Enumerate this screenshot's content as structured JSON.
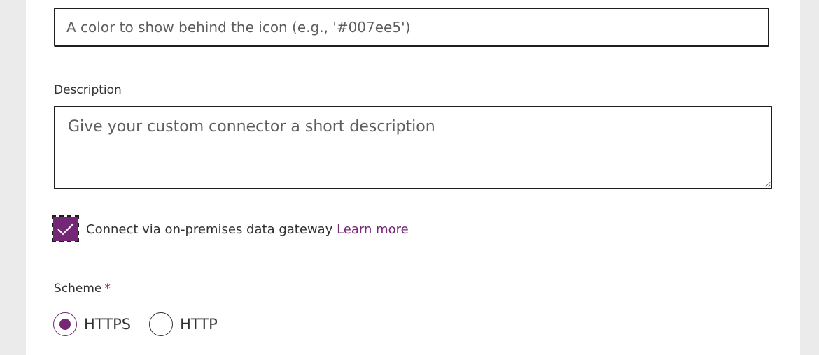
{
  "icon_background": {
    "placeholder": "A color to show behind the icon (e.g., '#007ee5')",
    "value": ""
  },
  "description": {
    "label": "Description",
    "placeholder": "Give your custom connector a short description",
    "value": ""
  },
  "gateway": {
    "checked": true,
    "label": "Connect via on-premises data gateway",
    "link_text": "Learn more"
  },
  "scheme": {
    "label": "Scheme",
    "required_marker": "*",
    "options": [
      {
        "label": "HTTPS",
        "selected": true
      },
      {
        "label": "HTTP",
        "selected": false
      }
    ]
  },
  "colors": {
    "accent": "#742774",
    "required": "#a4262c",
    "page_background": "#ebebeb",
    "panel": "#ffffff"
  }
}
